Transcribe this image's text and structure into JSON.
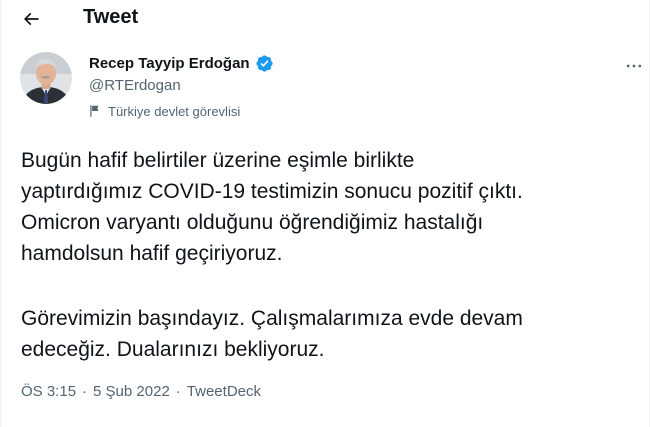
{
  "header": {
    "back_icon": "arrow-left-icon",
    "title": "Tweet"
  },
  "author": {
    "name": "Recep Tayyip Erdoğan",
    "handle": "@RTErdogan",
    "verified_icon": "verified-badge-icon",
    "label_icon": "flag-icon",
    "label": "Türkiye devlet görevlisi"
  },
  "more_icon": "more-horizontal-icon",
  "tweet": {
    "paragraph_1": "Bugün hafif belirtiler üzerine eşimle birlikte\nyaptırdığımız COVID-19 testimizin sonucu pozitif çıktı.\nOmicron varyantı olduğunu öğrendiğimiz hastalığı\nhamdolsun hafif geçiriyoruz.",
    "paragraph_2": "Görevimizin başındayız. Çalışmalarımıza evde devam\nedeceğiz. Dualarınızı bekliyoruz."
  },
  "meta": {
    "time": "ÖS 3:15",
    "separator": "·",
    "date": "5 Şub 2022",
    "source": "TweetDeck"
  },
  "colors": {
    "text_primary": "#0f1419",
    "text_secondary": "#536471",
    "verified_blue": "#1d9bf0",
    "border": "#eff3f4"
  }
}
